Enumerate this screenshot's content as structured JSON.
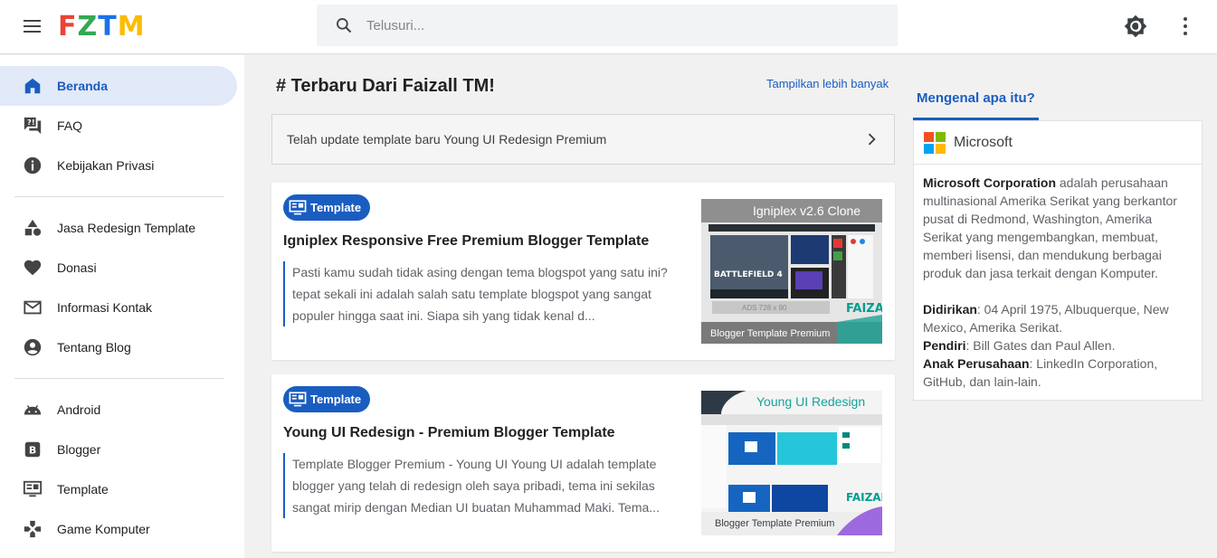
{
  "header": {
    "logo_letters": [
      "F",
      "Z",
      "T",
      "M"
    ],
    "logo_colors": [
      "#ea4335",
      "#34a853",
      "#1a73e8",
      "#fbbc05"
    ],
    "search_placeholder": "Telusuri..."
  },
  "sidebar": {
    "groups": [
      [
        {
          "label": "Beranda",
          "icon": "home-icon",
          "active": true
        },
        {
          "label": "FAQ",
          "icon": "faq-icon"
        },
        {
          "label": "Kebijakan Privasi",
          "icon": "info-icon"
        }
      ],
      [
        {
          "label": "Jasa Redesign Template",
          "icon": "shapes-icon"
        },
        {
          "label": "Donasi",
          "icon": "heart-icon"
        },
        {
          "label": "Informasi Kontak",
          "icon": "mail-icon"
        },
        {
          "label": "Tentang Blog",
          "icon": "account-icon"
        }
      ],
      [
        {
          "label": "Android",
          "icon": "android-icon"
        },
        {
          "label": "Blogger",
          "icon": "blogger-icon"
        },
        {
          "label": "Template",
          "icon": "monitor-icon"
        },
        {
          "label": "Game Komputer",
          "icon": "gamepad-icon"
        }
      ]
    ]
  },
  "main": {
    "section_title": "# Terbaru Dari Faizall TM!",
    "more_link": "Tampilkan lebih banyak",
    "update_text": "Telah update template baru Young UI Redesign Premium",
    "posts": [
      {
        "badge": "Template",
        "title": "Igniplex Responsive Free Premium Blogger Template",
        "excerpt": "Pasti kamu sudah tidak asing dengan tema blogspot yang satu ini? tepat sekali ini adalah salah satu template blogspot yang sangat populer hingga saat ini. Siapa sih yang tidak kenal d...",
        "thumb": {
          "heading": "Igniplex v2.6 Clone",
          "game": "BATTLEFIELD 4",
          "ads": "ADS 728 x 90",
          "brand": "FAIZALL",
          "footer": "Blogger Template Premium"
        }
      },
      {
        "badge": "Template",
        "title": "Young UI Redesign - Premium Blogger Template",
        "excerpt": "Template Blogger Premium - Young UI Young UI adalah template blogger yang telah di redesign oleh saya pribadi, tema ini sekilas sangat mirip dengan Median UI buatan Muhammad Maki. Tema...",
        "thumb": {
          "heading": "Young UI Redesign",
          "brand": "FAIZALL",
          "footer": "Blogger Template Premium"
        }
      }
    ]
  },
  "widget": {
    "tab_label": "Mengenal apa itu?",
    "name": "Microsoft",
    "logo_colors": [
      "#f25022",
      "#7fba00",
      "#00a4ef",
      "#ffb900"
    ],
    "intro_bold": "Microsoft Corporation",
    "intro_text": " adalah perusahaan multinasional Amerika Serikat yang berkantor pusat di Redmond, Washington, Amerika Serikat yang mengembangkan, membuat, memberi lisensi, dan mendukung berbagai produk dan jasa terkait dengan Komputer.",
    "facts": [
      {
        "label": "Didirikan",
        "value": ": 04 April 1975, Albuquerque, New Mexico, Amerika Serikat."
      },
      {
        "label": "Pendiri",
        "value": ": Bill Gates dan Paul Allen."
      },
      {
        "label": "Anak Perusahaan",
        "value": ": LinkedIn Corporation, GitHub, dan lain-lain."
      }
    ]
  },
  "colors": {
    "accent": "#1a5dc1",
    "active_nav_bg": "#e2e9f8"
  }
}
